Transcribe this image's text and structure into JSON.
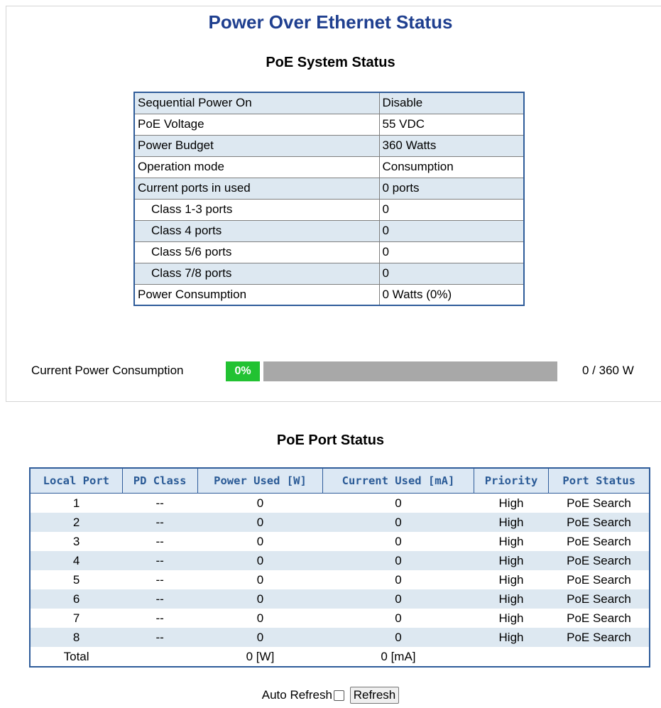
{
  "page_title": "Power Over Ethernet Status",
  "system_section": {
    "title": "PoE System Status",
    "rows": [
      {
        "label": "Sequential Power On",
        "value": "Disable",
        "indent": false
      },
      {
        "label": "PoE Voltage",
        "value": "55 VDC",
        "indent": false
      },
      {
        "label": "Power Budget",
        "value": "360 Watts",
        "indent": false
      },
      {
        "label": "Operation mode",
        "value": "Consumption",
        "indent": false
      },
      {
        "label": "Current ports in used",
        "value": "0 ports",
        "indent": false
      },
      {
        "label": "Class 1-3 ports",
        "value": "0",
        "indent": true
      },
      {
        "label": "Class 4 ports",
        "value": "0",
        "indent": true
      },
      {
        "label": "Class 5/6 ports",
        "value": "0",
        "indent": true
      },
      {
        "label": "Class 7/8 ports",
        "value": "0",
        "indent": true
      },
      {
        "label": "Power Consumption",
        "value": "0 Watts (0%)",
        "indent": false
      }
    ]
  },
  "consumption": {
    "label": "Current Power Consumption",
    "percent_text": "0%",
    "percent": 0,
    "value_text": "0 / 360 W",
    "fill_color": "#22c232",
    "bar_color": "#a8a8a8"
  },
  "port_section": {
    "title": "PoE Port Status",
    "columns": [
      "Local Port",
      "PD Class",
      "Power Used [W]",
      "Current Used [mA]",
      "Priority",
      "Port Status"
    ],
    "rows": [
      [
        "1",
        "--",
        "0",
        "0",
        "High",
        "PoE Search"
      ],
      [
        "2",
        "--",
        "0",
        "0",
        "High",
        "PoE Search"
      ],
      [
        "3",
        "--",
        "0",
        "0",
        "High",
        "PoE Search"
      ],
      [
        "4",
        "--",
        "0",
        "0",
        "High",
        "PoE Search"
      ],
      [
        "5",
        "--",
        "0",
        "0",
        "High",
        "PoE Search"
      ],
      [
        "6",
        "--",
        "0",
        "0",
        "High",
        "PoE Search"
      ],
      [
        "7",
        "--",
        "0",
        "0",
        "High",
        "PoE Search"
      ],
      [
        "8",
        "--",
        "0",
        "0",
        "High",
        "PoE Search"
      ]
    ],
    "total": {
      "label": "Total",
      "power": "0 [W]",
      "current": "0 [mA]"
    }
  },
  "controls": {
    "auto_refresh_label": "Auto Refresh",
    "auto_refresh_checked": false,
    "refresh_button": "Refresh"
  },
  "colors": {
    "title": "#1f3f8f",
    "table_border": "#2f5c9a",
    "header_text": "#2a5a96",
    "row_alt": "#dde8f1"
  }
}
